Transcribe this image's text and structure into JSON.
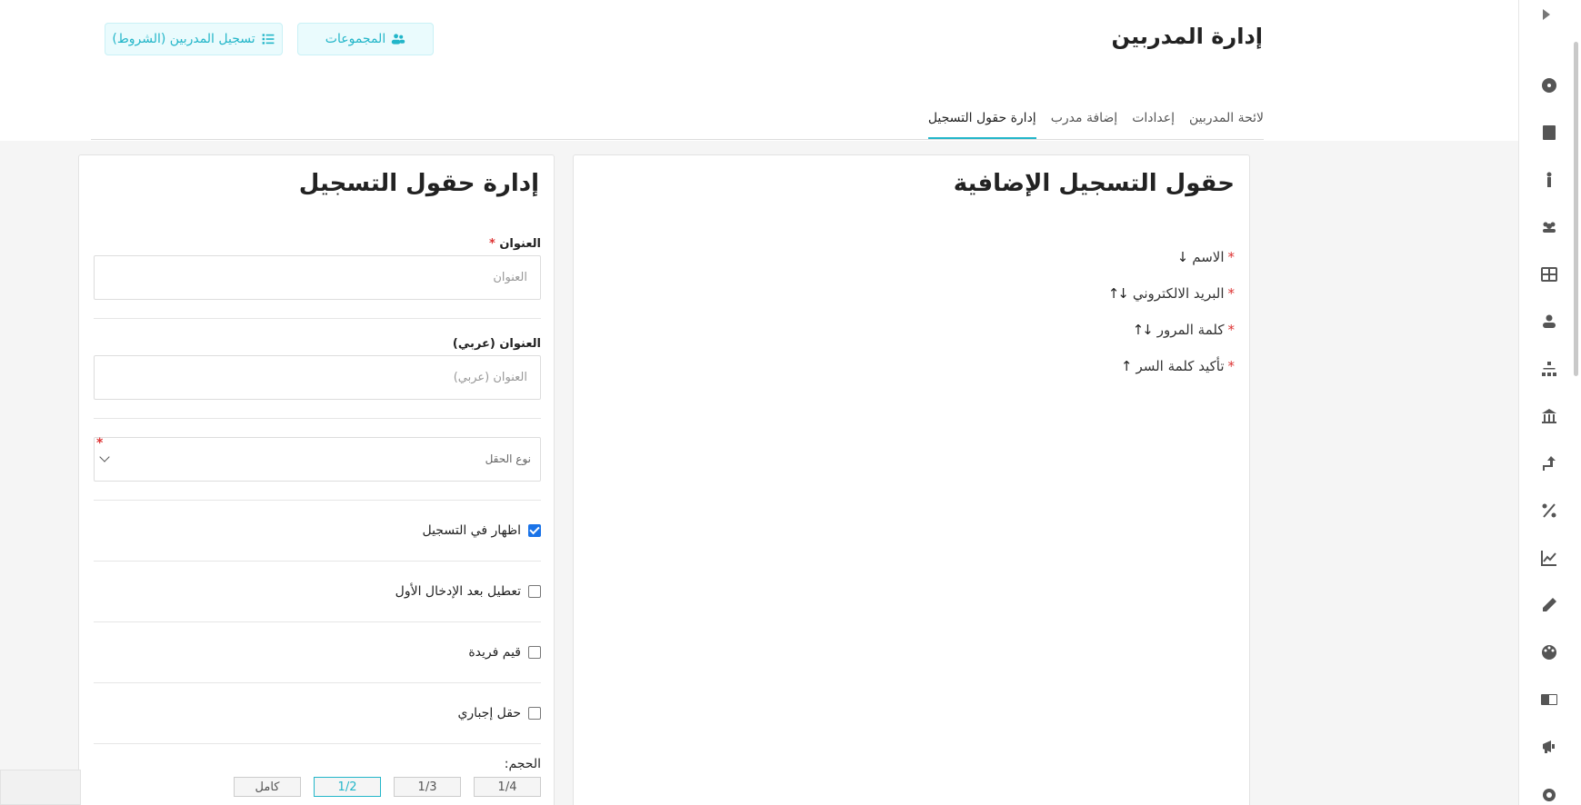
{
  "header": {
    "title": "إدارة المدربين",
    "groups_button": "المجموعات",
    "register_button": "تسجيل المدربين (الشروط)"
  },
  "tabs": [
    {
      "label": "لائحة المدربين"
    },
    {
      "label": "إعدادات"
    },
    {
      "label": "إضافة مدرب"
    },
    {
      "label": "إدارة حقول التسجيل"
    }
  ],
  "extra_fields": {
    "title": "حقول التسجيل الإضافية",
    "items": [
      {
        "label": "الاسم",
        "arrows": "↓"
      },
      {
        "label": "البريد الالكتروني",
        "arrows": "↓↑"
      },
      {
        "label": "كلمة المرور",
        "arrows": "↓↑"
      },
      {
        "label": "تأكيد كلمة السر",
        "arrows": "↑"
      }
    ]
  },
  "form": {
    "title": "إدارة حقول التسجيل",
    "title_label": "العنوان",
    "title_placeholder": "العنوان",
    "title_ar_label": "العنوان (عربي)",
    "title_ar_placeholder": "العنوان (عربي)",
    "field_type_placeholder": "نوع الحقل",
    "show_in_registration": "اظهار في التسجيل",
    "disable_after_first": "تعطيل بعد الإدخال الأول",
    "unique_values": "قيم فريدة",
    "required_field": "حقل إجباري",
    "size_label": "الحجم:",
    "sizes": [
      "1/4",
      "1/3",
      "1/2",
      "كامل"
    ]
  },
  "colors": {
    "accent": "#23b6c9",
    "required": "#dd3333"
  }
}
